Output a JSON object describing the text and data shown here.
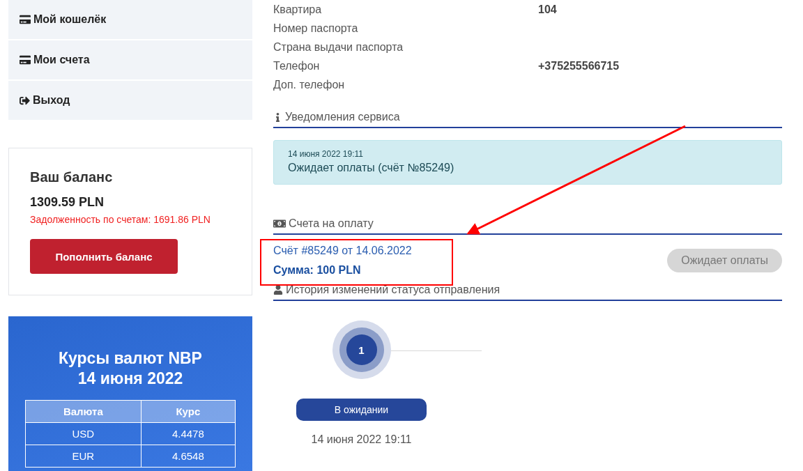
{
  "sidebar": {
    "items": [
      {
        "label": "Мой кошелёк",
        "kind": "card"
      },
      {
        "label": "Мои счета",
        "kind": "card"
      },
      {
        "label": "Выход",
        "kind": "exit"
      }
    ]
  },
  "balance": {
    "title": "Ваш баланс",
    "amount": "1309.59 PLN",
    "debt": "Задолженность по счетам: 1691.86 PLN",
    "button": "Пополнить баланс"
  },
  "rates": {
    "title": "Курсы валют NBP",
    "date": "14 июня 2022",
    "columns": [
      "Валюта",
      "Курс"
    ],
    "rows": [
      [
        "USD",
        "4.4478"
      ],
      [
        "EUR",
        "4.6548"
      ]
    ]
  },
  "details": [
    {
      "label": "Квартира",
      "value": "104"
    },
    {
      "label": "Номер паспорта"
    },
    {
      "label": "Страна выдачи паспорта"
    },
    {
      "label": "Телефон",
      "value": "+375255566715"
    },
    {
      "label": "Доп. телефон"
    }
  ],
  "notifications": {
    "heading": "Уведомления сервиса",
    "items": [
      {
        "date": "14 июня 2022 19:11",
        "text": "Ожидает оплаты (счёт №85249)"
      }
    ]
  },
  "invoices": {
    "heading": "Счета на оплату",
    "items": [
      {
        "title": "Счёт #85249 от 14.06.2022",
        "sum": "Сумма: 100 PLN",
        "status": "Ожидает оплаты",
        "disabled": true
      }
    ]
  },
  "history": {
    "heading": "История изменений статуса отправления",
    "steps": [
      {
        "number": "1",
        "status": "В ожидании",
        "date": "14 июня 2022 19:11"
      }
    ]
  }
}
